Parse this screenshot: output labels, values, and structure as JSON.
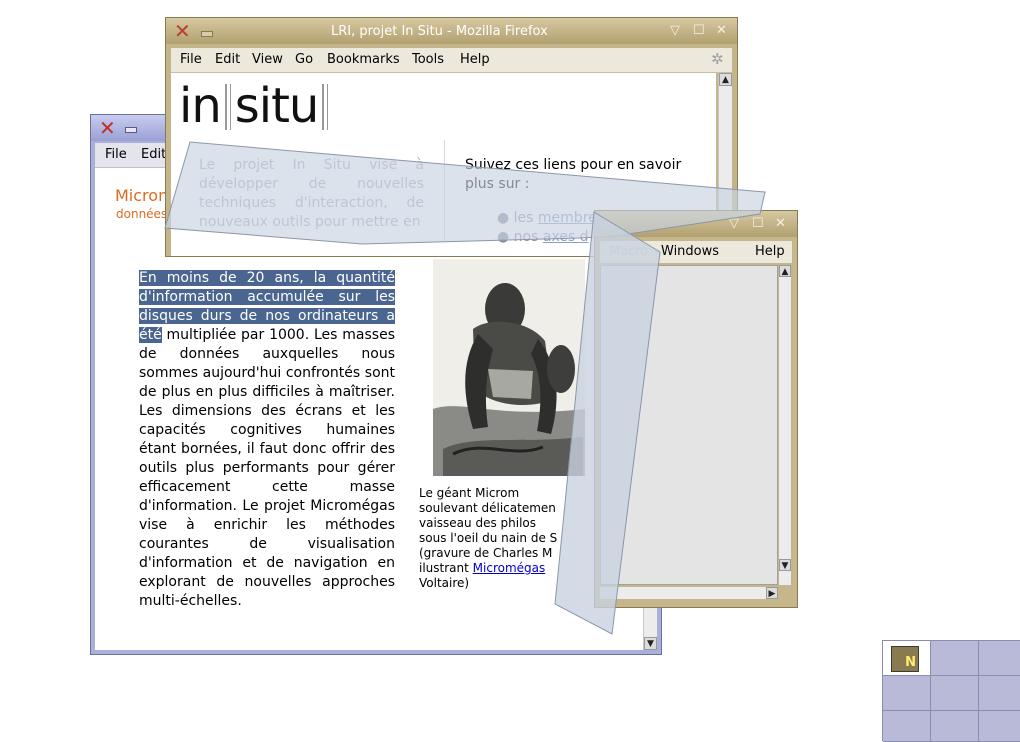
{
  "micro_window": {
    "menu": [
      "File",
      "Edit"
    ],
    "heading": "Microm",
    "subheading": "données",
    "paragraph_selected": "En moins de 20 ans, la quantité d'information accumulée sur les disques durs de nos ordinateurs a été",
    "paragraph_rest": " multipliée par 1000. Les masses de données auxquelles nous sommes aujourd'hui confrontés sont de plus en plus difficiles à maîtriser. Les dimensions des écrans et les capacités cognitives humaines étant bornées, il faut donc offrir des outils plus performants pour gérer efficacement cette masse d'information. Le projet Micromégas vise à enrichir les méthodes courantes de visualisation d'information et de navigation en explorant de nouvelles approches multi-échelles.",
    "caption": "Le géant Microm\nsoulevant délicatemen\nvaisseau des philos\nsous l'oeil du nain de S\n(gravure de Charles M\nilustrant ",
    "caption_link": "Micromégas",
    "caption_end": "\nVoltaire)"
  },
  "firefox_window": {
    "title": "LRI, projet In Situ - Mozilla Firefox",
    "menu": [
      "File",
      "Edit",
      "View",
      "Go",
      "Bookmarks",
      "Tools",
      "Help"
    ],
    "logo_left": "in",
    "logo_right": "situ",
    "left_text": "Le projet In Situ vise à développer de nouvelles techniques d'interaction, de nouveaux outils pour mettre en",
    "right_text": "Suivez ces liens pour en savoir plus sur :",
    "link_items": [
      {
        "prefix": "les ",
        "link": "membre"
      },
      {
        "prefix": "nos ",
        "link": "axes d"
      }
    ]
  },
  "third_window": {
    "menu": [
      "Macro",
      "Windows",
      "Help"
    ]
  },
  "pager": {
    "active_app_letter": "N"
  }
}
